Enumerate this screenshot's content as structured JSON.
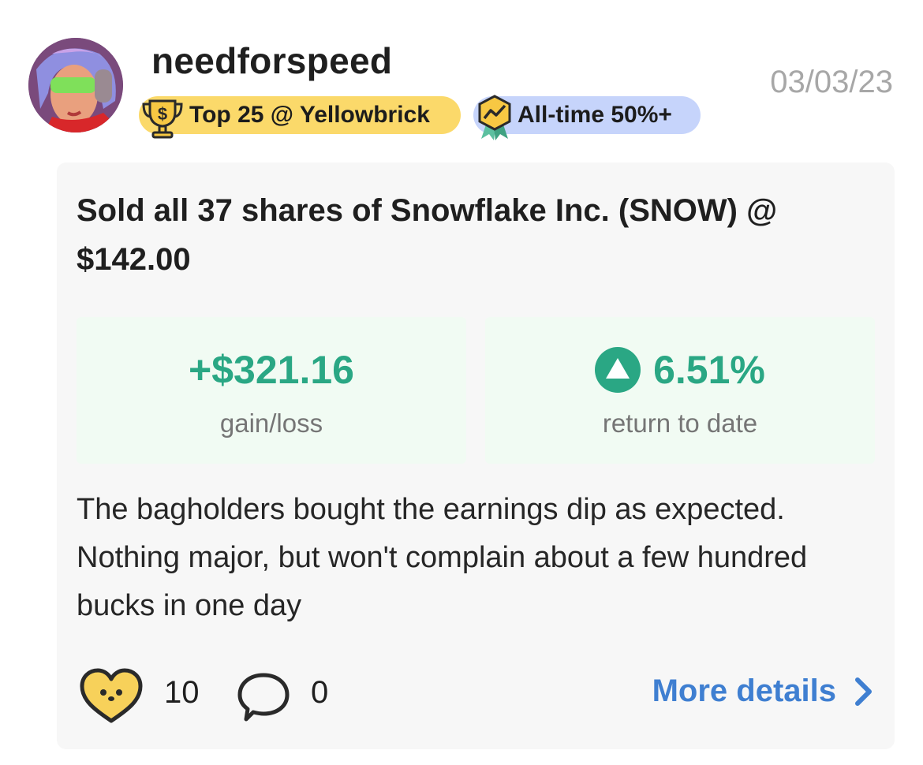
{
  "colors": {
    "gain_green": "#2aa784",
    "link_blue": "#3f7fd1",
    "badge_yellow": "#fbd96a",
    "badge_blue": "#c6d4fb",
    "card_bg": "#f7f7f7",
    "stat_bg": "#f1fbf3",
    "muted_text": "#757575"
  },
  "header": {
    "username": "needforspeed",
    "date": "03/03/23",
    "avatar_icon": "user-avatar",
    "badges": [
      {
        "label": "Top 25 @ Yellowbrick",
        "icon": "trophy-dollar-icon"
      },
      {
        "label": "All-time 50%+",
        "icon": "trending-award-icon"
      }
    ]
  },
  "post": {
    "title": "Sold all 37 shares of Snowflake Inc. (SNOW) @ $142.00",
    "stats": {
      "gain_value": "+$321.16",
      "gain_label": "gain/loss",
      "return_value": "6.51%",
      "return_label": "return to date",
      "return_icon": "triangle-up-icon"
    },
    "body": "The bagholders bought the earnings dip as expected. Nothing major, but won't complain about a few hundred bucks in one day"
  },
  "footer": {
    "like_icon": "heart-face-icon",
    "like_count": "10",
    "comment_icon": "speech-bubble-icon",
    "comment_count": "0",
    "more_details_label": "More details",
    "more_icon": "chevron-right-icon"
  }
}
